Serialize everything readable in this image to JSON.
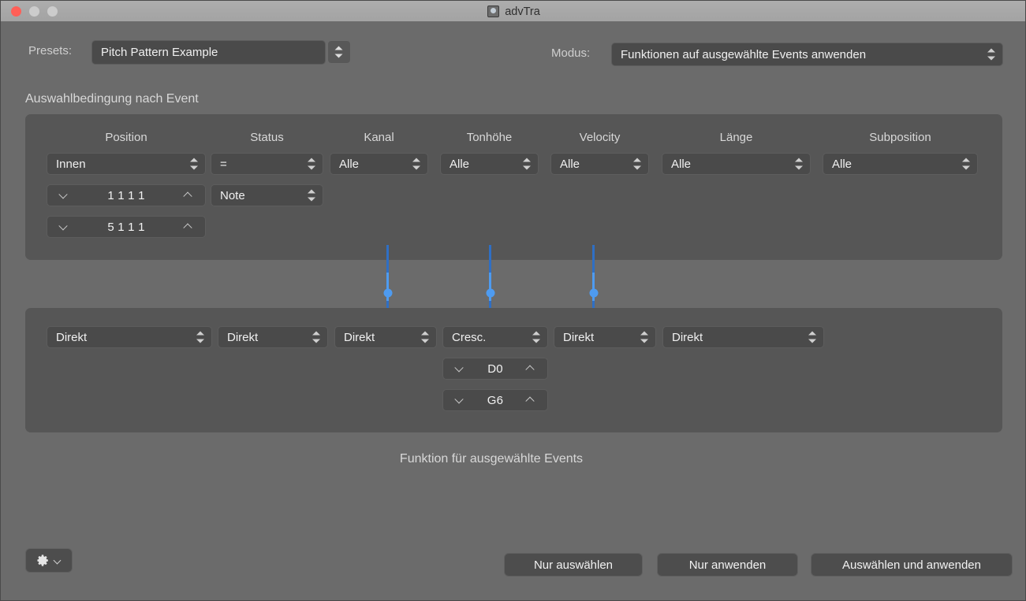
{
  "window": {
    "title": "advTra",
    "app_icon": "app-icon",
    "traffic_lights": [
      "close",
      "minimize",
      "zoom"
    ]
  },
  "toolbar": {
    "presets_label": "Presets:",
    "presets_value": "Pitch Pattern Example",
    "modus_label": "Modus:",
    "modus_value": "Funktionen auf ausgewählte Events anwenden"
  },
  "condition_section": {
    "heading": "Auswahlbedingung nach Event",
    "columns": [
      {
        "header": "Position",
        "value": "Innen"
      },
      {
        "header": "Status",
        "value": "="
      },
      {
        "header": "Kanal",
        "value": "Alle"
      },
      {
        "header": "Tonhöhe",
        "value": "Alle"
      },
      {
        "header": "Velocity",
        "value": "Alle"
      },
      {
        "header": "Länge",
        "value": "Alle"
      },
      {
        "header": "Subposition",
        "value": "Alle"
      }
    ],
    "position_from": "1 1 1    1",
    "position_to": "5 1 1    1",
    "status_value": "Note"
  },
  "function_section": {
    "caption": "Funktion für ausgewählte Events",
    "operations": [
      "Direkt",
      "Direkt",
      "Direkt",
      "Cresc.",
      "Direkt",
      "Direkt"
    ],
    "pitch_from": "D0",
    "pitch_to": "G6"
  },
  "footer": {
    "gear_label": "gear-icon",
    "buttons": [
      "Nur auswählen",
      "Nur anwenden",
      "Auswählen und anwenden"
    ]
  },
  "colors": {
    "window_bg": "#6b6b6b",
    "panel_bg": "#565656",
    "control_bg": "#4a4a4a",
    "accent_blue": "#4e9bf0",
    "accent_blue_dark": "#2f6fc4",
    "titlebar": "#a8a8a8",
    "close_red": "#ff5f57"
  }
}
